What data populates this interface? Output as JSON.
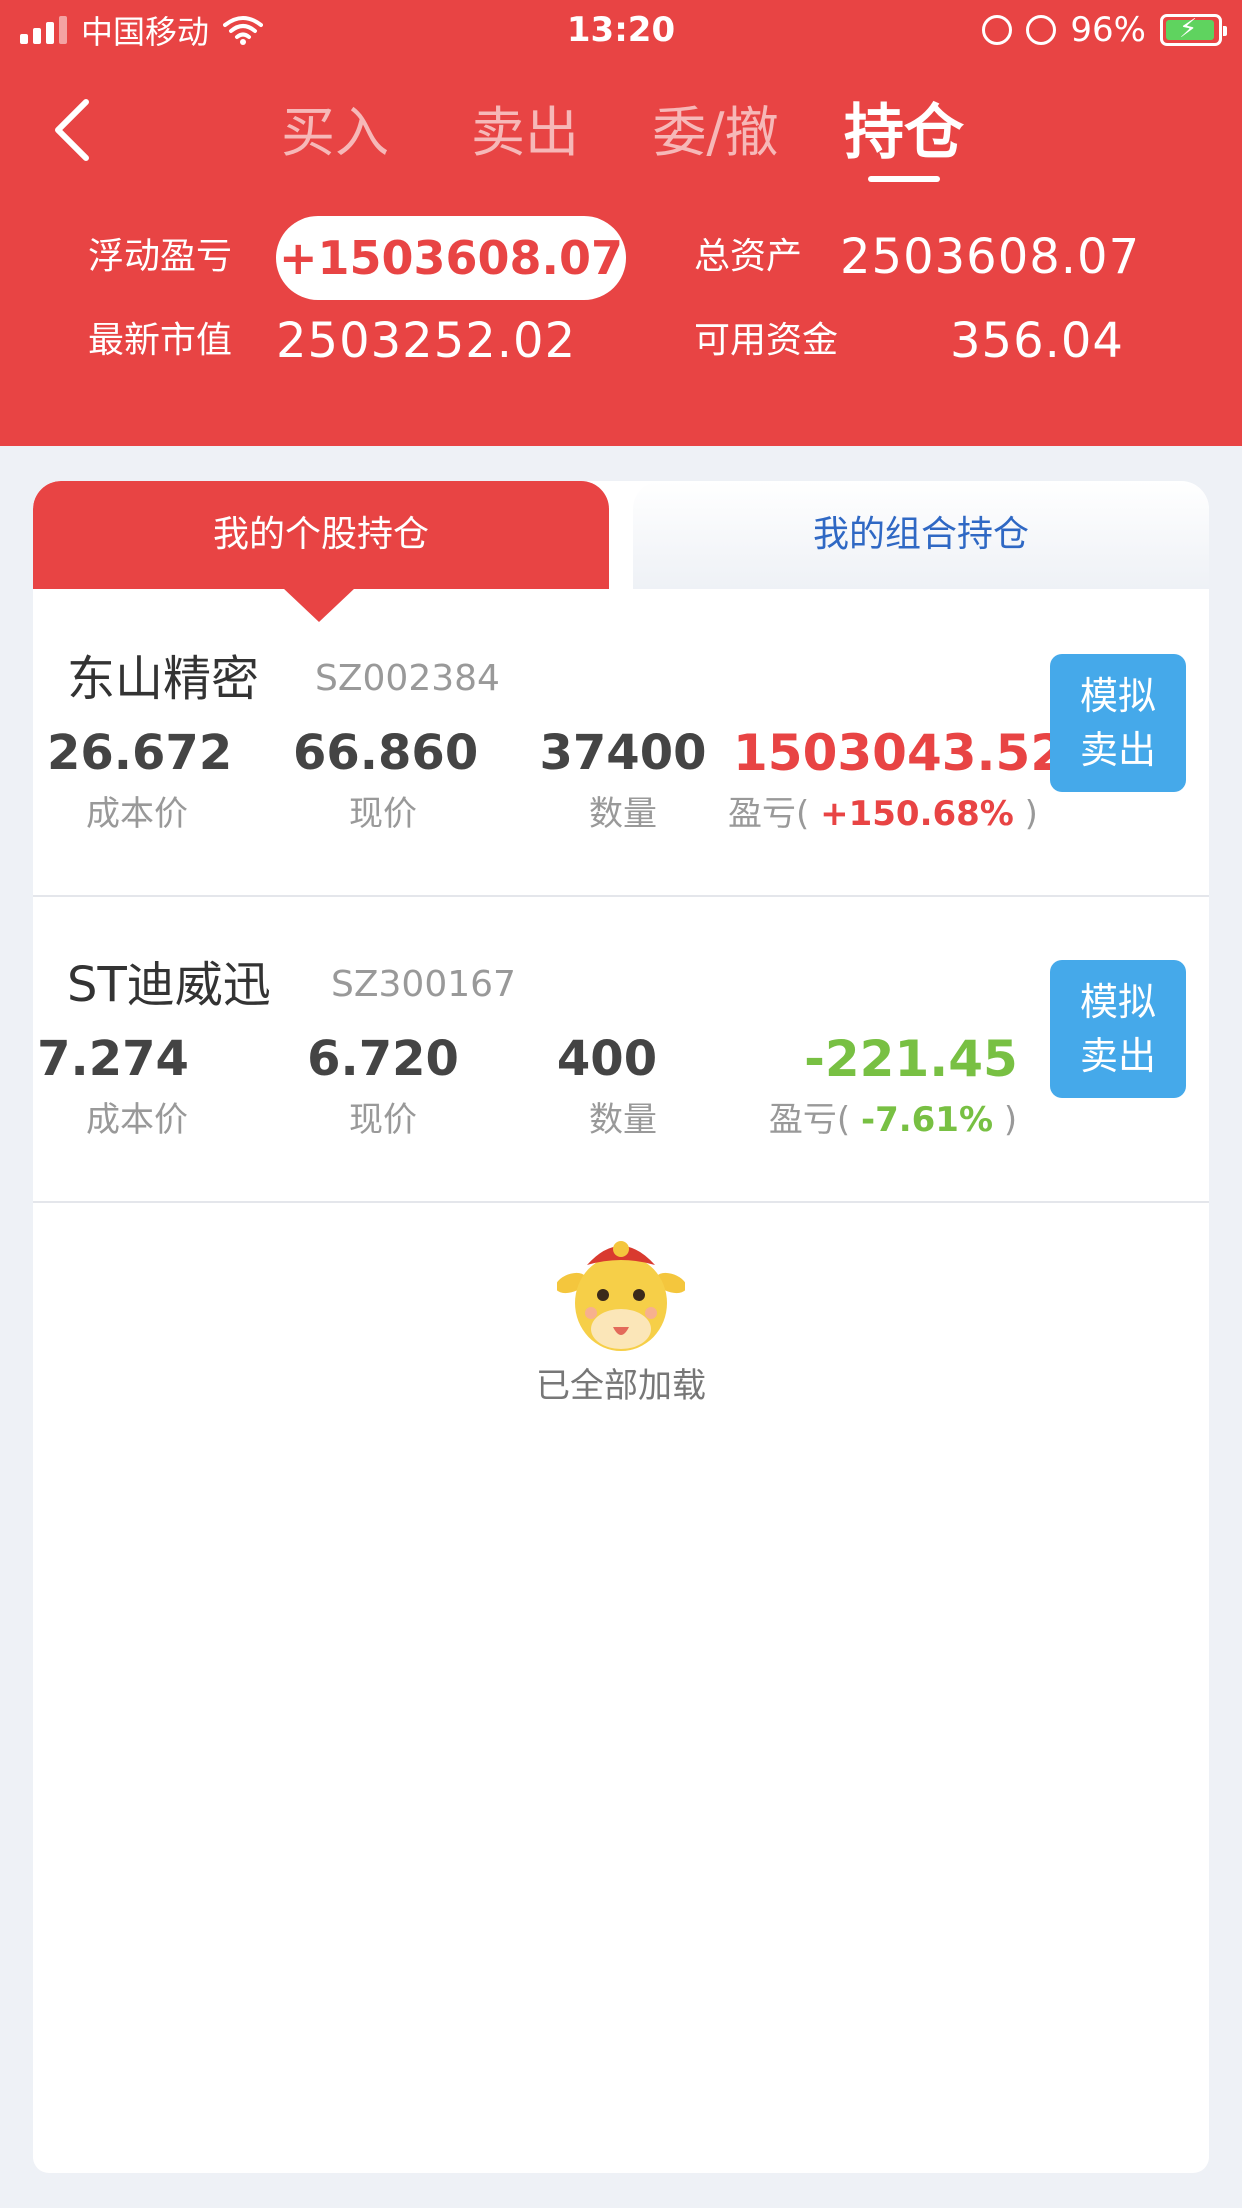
{
  "status_bar": {
    "carrier": "中国移动",
    "time": "13:20",
    "battery": "96%",
    "battery_level": 0.96
  },
  "nav": {
    "tabs": [
      {
        "label": "买入"
      },
      {
        "label": "卖出"
      },
      {
        "label": "委/撤"
      },
      {
        "label": "持仓"
      }
    ],
    "active_tab": "持仓"
  },
  "summary": {
    "float_pl_label": "浮动盈亏",
    "float_pl_value": "+1503608.07",
    "total_assets_label": "总资产",
    "total_assets_value": "2503608.07",
    "market_value_label": "最新市值",
    "market_value_value": "2503252.02",
    "available_funds_label": "可用资金",
    "available_funds_value": "356.04"
  },
  "segments": {
    "individual": "我的个股持仓",
    "portfolio": "我的组合持仓"
  },
  "column_labels": {
    "cost": "成本价",
    "current": "现价",
    "quantity": "数量",
    "pl": "盈亏"
  },
  "holdings": [
    {
      "name": "东山精密",
      "code": "SZ002384",
      "cost": "26.672",
      "current": "66.860",
      "quantity": "37400",
      "pl": "1503043.52",
      "pl_pct": "+150.68%",
      "pl_color": "#e84444"
    },
    {
      "name": "ST迪威迅",
      "code": "SZ300167",
      "cost": "7.274",
      "current": "6.720",
      "quantity": "400",
      "pl": "-221.45",
      "pl_pct": "-7.61%",
      "pl_color": "#78c043"
    }
  ],
  "sell_button": {
    "line1": "模拟",
    "line2": "卖出"
  },
  "footer": {
    "loaded_text": "已全部加载"
  },
  "colors": {
    "brand": "#e84444",
    "button": "#45a9ea",
    "tab_blue": "#2f68c4"
  }
}
